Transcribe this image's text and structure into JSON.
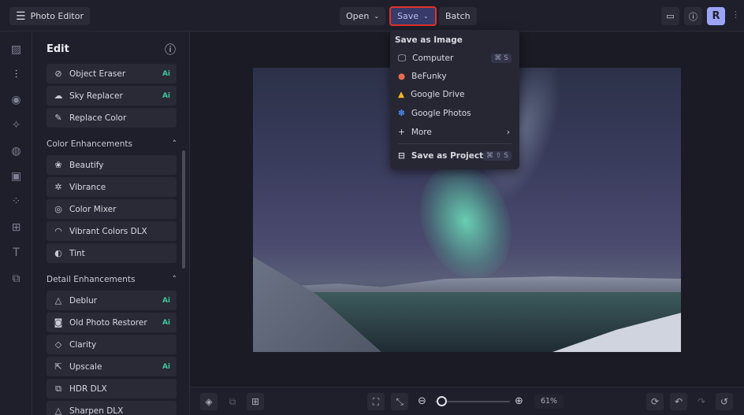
{
  "header": {
    "app_title": "Photo Editor",
    "open": "Open",
    "save": "Save",
    "batch": "Batch",
    "avatar": "R"
  },
  "save_menu": {
    "heading": "Save as Image",
    "items": [
      {
        "label": "Computer",
        "shortcut": "⌘ S"
      },
      {
        "label": "BeFunky"
      },
      {
        "label": "Google Drive"
      },
      {
        "label": "Google Photos"
      },
      {
        "label": "More"
      }
    ],
    "project": {
      "label": "Save as Project",
      "shortcut": "⌘ ⇧ S"
    }
  },
  "panel": {
    "title": "Edit",
    "edit_items": [
      {
        "label": "Object Eraser",
        "badge": "Ai"
      },
      {
        "label": "Sky Replacer",
        "badge": "Ai"
      },
      {
        "label": "Replace Color"
      }
    ],
    "color_section": "Color Enhancements",
    "color_items": [
      {
        "label": "Beautify"
      },
      {
        "label": "Vibrance"
      },
      {
        "label": "Color Mixer"
      },
      {
        "label": "Vibrant Colors DLX"
      },
      {
        "label": "Tint"
      }
    ],
    "detail_section": "Detail Enhancements",
    "detail_items": [
      {
        "label": "Deblur",
        "badge": "Ai"
      },
      {
        "label": "Old Photo Restorer",
        "badge": "Ai"
      },
      {
        "label": "Clarity"
      },
      {
        "label": "Upscale",
        "badge": "Ai"
      },
      {
        "label": "HDR DLX"
      },
      {
        "label": "Sharpen DLX"
      }
    ]
  },
  "zoom": {
    "value": "61%",
    "fraction": 0.08
  }
}
